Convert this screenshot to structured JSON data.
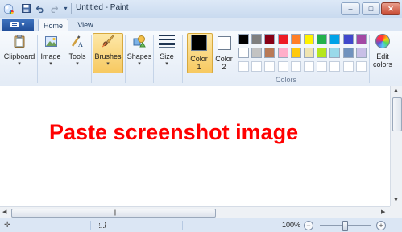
{
  "window": {
    "title": "Untitled - Paint"
  },
  "quick_access": {
    "items": [
      "paint-icon",
      "save-icon",
      "undo-icon",
      "redo-icon",
      "customize-icon"
    ]
  },
  "window_controls": {
    "minimize": "–",
    "maximize": "□",
    "close": "✕"
  },
  "tabs": {
    "home": "Home",
    "view": "View"
  },
  "ribbon": {
    "clipboard": "Clipboard",
    "image": "Image",
    "tools": "Tools",
    "brushes": "Brushes",
    "shapes": "Shapes",
    "size": "Size",
    "color1_line1": "Color",
    "color1_line2": "1",
    "color2_line1": "Color",
    "color2_line2": "2",
    "colors_group": "Colors",
    "edit_line1": "Edit",
    "edit_line2": "colors"
  },
  "colors": {
    "color1": "#000000",
    "color2": "#ffffff",
    "palette_row1": [
      "#000000",
      "#7f7f7f",
      "#880015",
      "#ed1c24",
      "#ff7f27",
      "#fff200",
      "#22b14c",
      "#00a2e8",
      "#3f48cc",
      "#a349a4"
    ],
    "palette_row2": [
      "#ffffff",
      "#c3c3c3",
      "#b97a57",
      "#ffaec9",
      "#ffc90e",
      "#efe4b0",
      "#b5e61d",
      "#99d9ea",
      "#7092be",
      "#c8bfe7"
    ],
    "palette_row3": [
      "#ffffff",
      "#ffffff",
      "#ffffff",
      "#ffffff",
      "#ffffff",
      "#ffffff",
      "#ffffff",
      "#ffffff",
      "#ffffff",
      "#ffffff"
    ]
  },
  "canvas": {
    "text": "Paste screenshot image",
    "text_color": "#ff0000"
  },
  "statusbar": {
    "zoom": "100%",
    "zoom_out": "−",
    "zoom_in": "+"
  }
}
